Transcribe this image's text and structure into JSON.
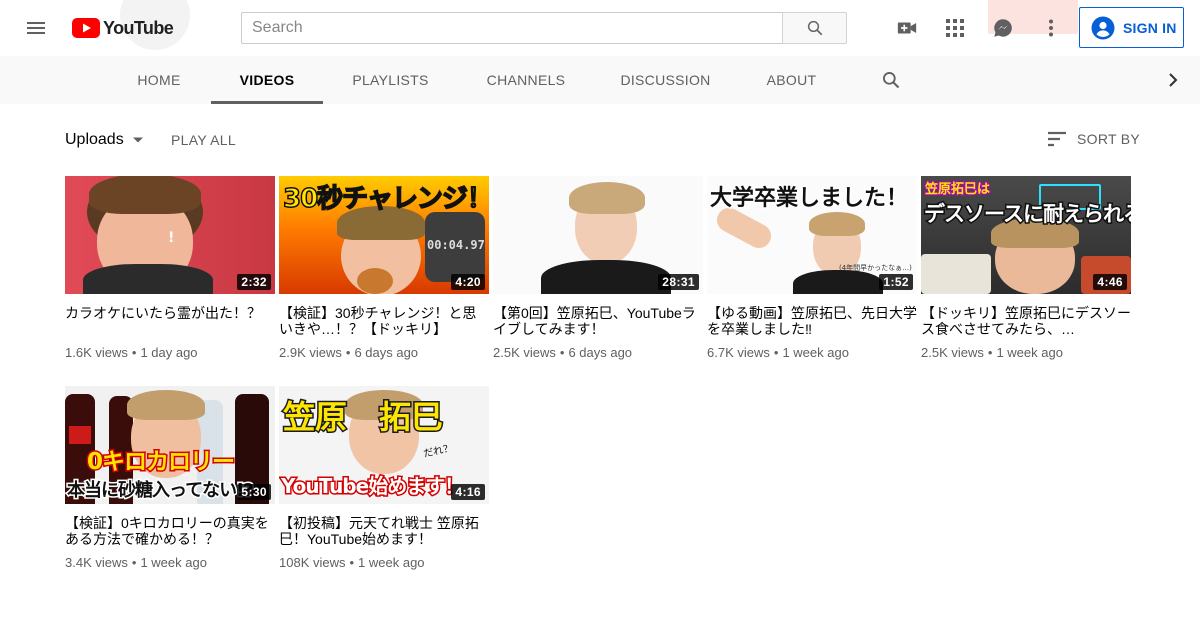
{
  "masthead": {
    "logo_text": "YouTube",
    "search_placeholder": "Search",
    "signin_label": "SIGN IN",
    "icons": [
      "menu-icon",
      "search-icon",
      "create-video-icon",
      "apps-grid-icon",
      "messages-icon",
      "more-vert-icon",
      "account-circle-icon"
    ],
    "accent_color": "#065fd4",
    "brand_red": "#ff0000"
  },
  "tabs": {
    "items": [
      "HOME",
      "VIDEOS",
      "PLAYLISTS",
      "CHANNELS",
      "DISCUSSION",
      "ABOUT"
    ],
    "active": "VIDEOS"
  },
  "subheader": {
    "uploads_label": "Uploads",
    "play_all_label": "PLAY ALL",
    "sort_by_label": "SORT BY"
  },
  "videos": [
    {
      "title": "カラオケにいたら霊が出た！？",
      "duration": "2:32",
      "views": "1.6K views",
      "age": "1 day ago",
      "thumb_caption": "!"
    },
    {
      "title": "【検証】30秒チャレンジ！と思いきや…！？【ドッキリ】",
      "duration": "4:20",
      "views": "2.9K views",
      "age": "6 days ago",
      "thumb_caption": "30秒チャレンジ！",
      "thumb_caption_2": "00:04.97"
    },
    {
      "title": "【第0回】笠原拓巳、YouTubeライブしてみます！",
      "duration": "28:31",
      "views": "2.5K views",
      "age": "6 days ago"
    },
    {
      "title": "【ゆる動画】笠原拓巳、先日大学を卒業しました‼",
      "duration": "1:52",
      "views": "6.7K views",
      "age": "1 week ago",
      "thumb_caption": "大学卒業しました！",
      "thumb_caption_2": "(4年間早かったなぁ…)"
    },
    {
      "title": "【ドッキリ】笠原拓巳にデスソース食べさせてみたら、…",
      "duration": "4:46",
      "views": "2.5K views",
      "age": "1 week ago",
      "thumb_caption": "笠原拓巳は",
      "thumb_caption_2": "デスソースに耐えられる!?"
    },
    {
      "title": "【検証】0キロカロリーの真実をある方法で確かめる！？",
      "duration": "5:30",
      "views": "3.4K views",
      "age": "1 week ago",
      "thumb_caption": "0キロカロリー",
      "thumb_caption_2": "本当に砂糖入ってない!?"
    },
    {
      "title": "【初投稿】元天てれ戦士 笠原拓巳！YouTube始めます！",
      "duration": "4:16",
      "views": "108K views",
      "age": "1 week ago",
      "thumb_caption": "笠原　拓巳",
      "thumb_caption_2": "YouTube始めます！",
      "thumb_caption_3": "だれ？"
    }
  ]
}
